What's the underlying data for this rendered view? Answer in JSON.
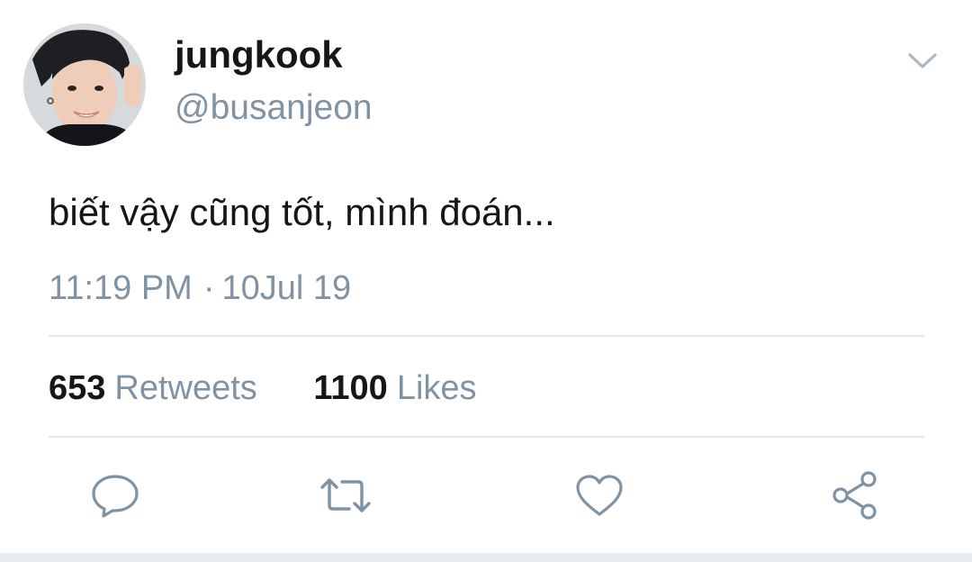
{
  "user": {
    "display_name": "jungkook",
    "handle": "@busanjeon",
    "avatar_alt": "avatar"
  },
  "tweet": {
    "text": "biết vậy cũng tốt, mình đoán...",
    "time": "11:19 PM",
    "separator": "·",
    "date": "10Jul 19"
  },
  "stats": {
    "retweets_count": "653",
    "retweets_label": "Retweets",
    "likes_count": "1100",
    "likes_label": "Likes"
  },
  "actions": {
    "reply_icon": "reply-icon",
    "retweet_icon": "retweet-icon",
    "like_icon": "heart-icon",
    "share_icon": "share-icon"
  },
  "colors": {
    "primary_text": "#14171a",
    "secondary_text": "#8193a3",
    "divider": "#e1e8ed",
    "icon": "#8193a3"
  }
}
